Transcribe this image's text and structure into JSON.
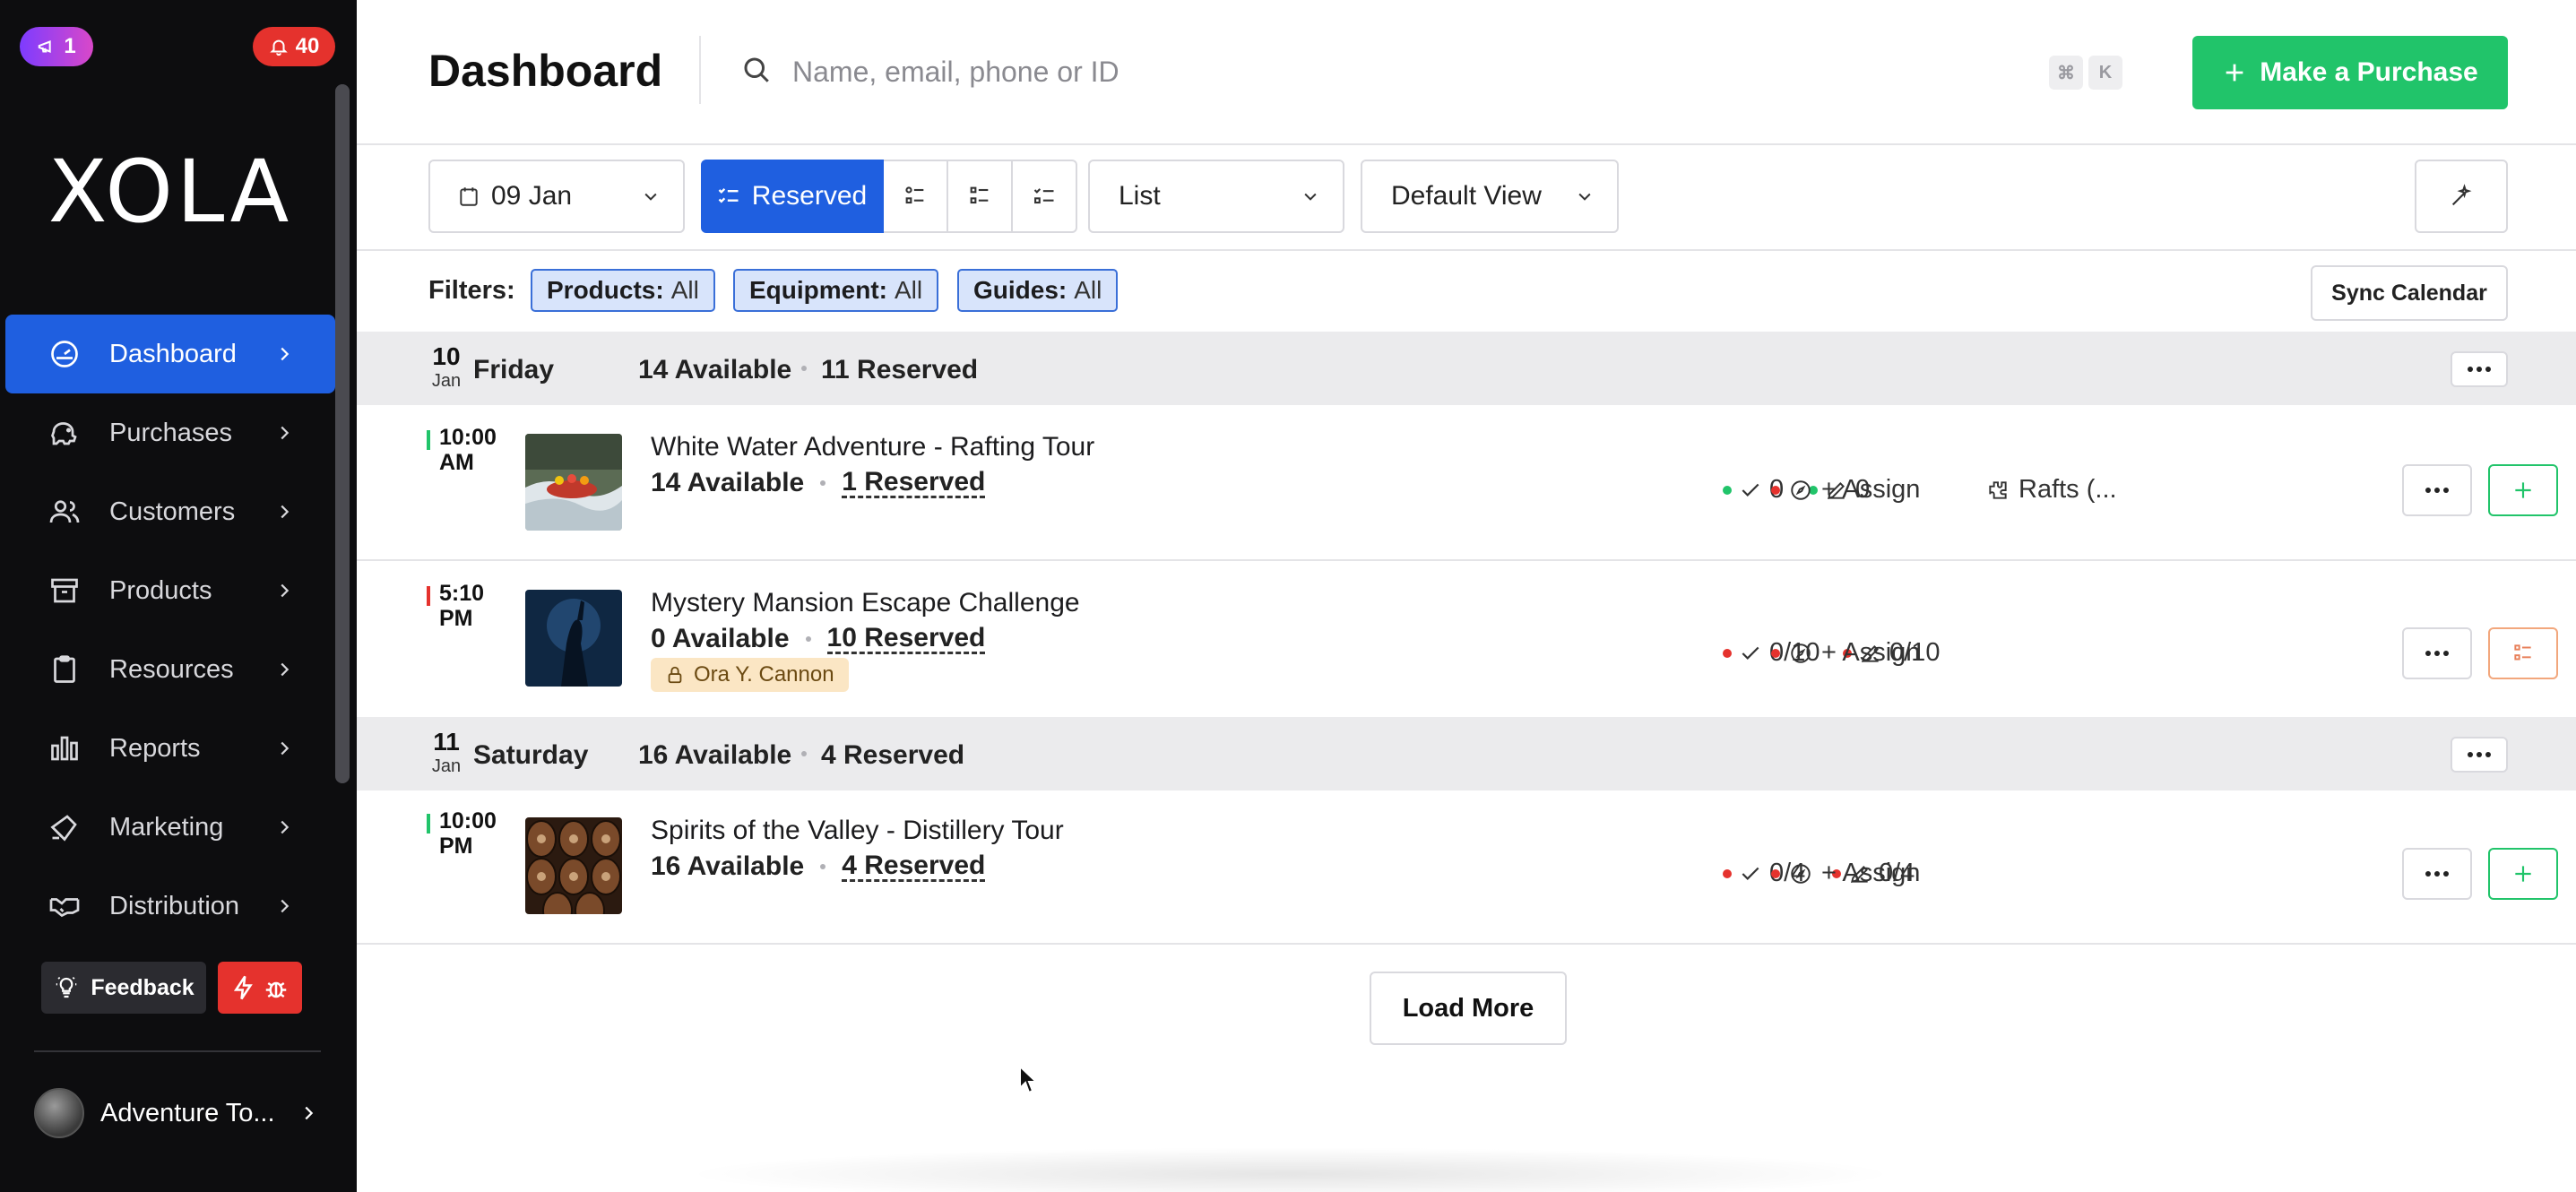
{
  "sidebar": {
    "notif_purple_count": "1",
    "notif_red_count": "40",
    "logo": "XOLA",
    "items": [
      {
        "label": "Dashboard",
        "icon": "gauge-icon",
        "active": true
      },
      {
        "label": "Purchases",
        "icon": "piggy-bank-icon"
      },
      {
        "label": "Customers",
        "icon": "users-icon"
      },
      {
        "label": "Products",
        "icon": "archive-box-icon"
      },
      {
        "label": "Resources",
        "icon": "clipboard-icon"
      },
      {
        "label": "Reports",
        "icon": "bar-chart-icon"
      },
      {
        "label": "Marketing",
        "icon": "megaphone-icon"
      },
      {
        "label": "Distribution",
        "icon": "handshake-icon"
      }
    ],
    "feedback_label": "Feedback",
    "account_name": "Adventure To..."
  },
  "header": {
    "title": "Dashboard",
    "search_placeholder": "Name, email, phone or ID",
    "kbd_cmd": "⌘",
    "kbd_k": "K",
    "purchase_label": "Make a Purchase"
  },
  "toolbar": {
    "date": "09 Jan",
    "reserved_label": "Reserved",
    "list_label": "List",
    "view_label": "Default View"
  },
  "filters": {
    "label": "Filters:",
    "chips": [
      {
        "key": "Products:",
        "value": "All"
      },
      {
        "key": "Equipment:",
        "value": "All"
      },
      {
        "key": "Guides:",
        "value": "All"
      }
    ],
    "sync_label": "Sync Calendar"
  },
  "days": [
    {
      "num": "10",
      "mon": "Jan",
      "name": "Friday",
      "available": "14 Available",
      "reserved": "11 Reserved",
      "events": [
        {
          "time_line1": "10:00",
          "time_line2": "AM",
          "status_color": "#21c46a",
          "title": "White Water Adventure - Rafting Tour",
          "available": "14 Available",
          "reserved": "1 Reserved",
          "check_value": "0",
          "check_color": "#21c46a",
          "edit_value": "0",
          "edit_color": "#21c46a",
          "assign_label": "+ Assign",
          "resource_label": "Rafts (...",
          "action": "plus-icon"
        },
        {
          "time_line1": "5:10",
          "time_line2": "PM",
          "status_color": "#e5322d",
          "title": "Mystery Mansion Escape Challenge",
          "available": "0 Available",
          "reserved": "10 Reserved",
          "guide": "Ora Y. Cannon",
          "check_value": "0/10",
          "check_color": "#e5322d",
          "edit_value": "0/10",
          "edit_color": "#e5322d",
          "assign_label": "+ Assign",
          "action": "list-icon"
        }
      ]
    },
    {
      "num": "11",
      "mon": "Jan",
      "name": "Saturday",
      "available": "16 Available",
      "reserved": "4 Reserved",
      "events": [
        {
          "time_line1": "10:00",
          "time_line2": "PM",
          "status_color": "#21c46a",
          "title": "Spirits of the Valley - Distillery Tour",
          "available": "16 Available",
          "reserved": "4 Reserved",
          "check_value": "0/4",
          "check_color": "#e5322d",
          "edit_value": "0/4",
          "edit_color": "#e5322d",
          "assign_label": "+ Assign",
          "action": "plus-icon"
        }
      ]
    }
  ],
  "load_more_label": "Load More"
}
